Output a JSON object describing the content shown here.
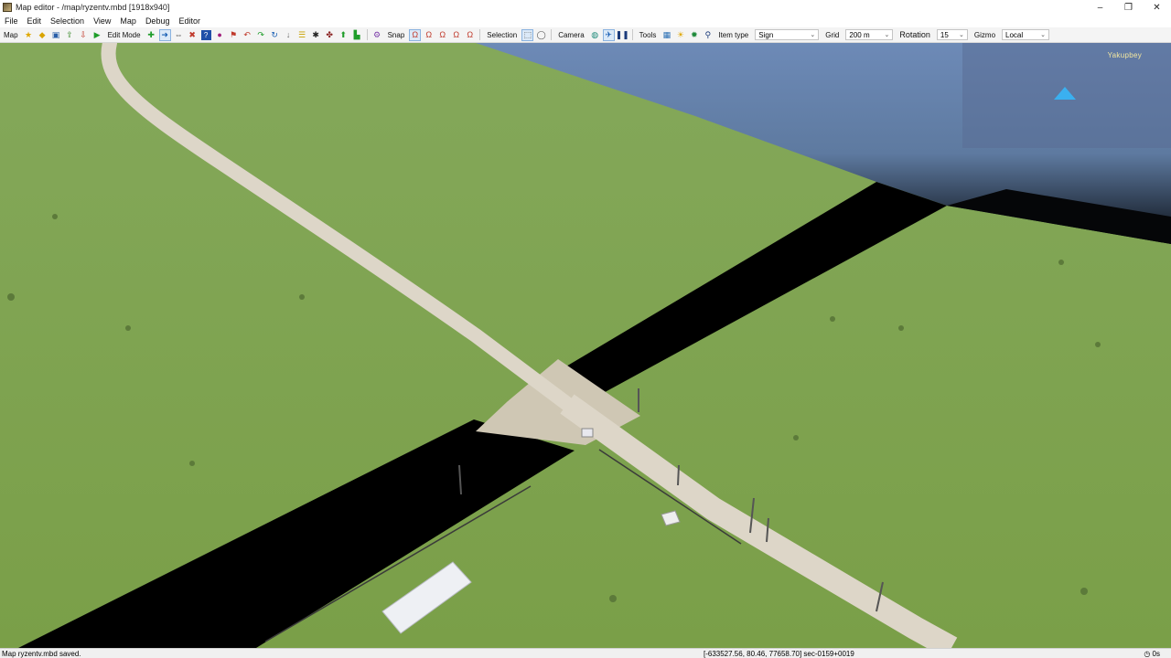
{
  "window": {
    "title": "Map editor - /map/ryzentv.mbd [1918x940]",
    "controls": {
      "minimize": "–",
      "maximize": "❐",
      "close": "✕"
    }
  },
  "menu": [
    "File",
    "Edit",
    "Selection",
    "View",
    "Map",
    "Debug",
    "Editor"
  ],
  "toolbar": {
    "map_label": "Map",
    "edit_mode_label": "Edit Mode",
    "snap_label": "Snap",
    "selection_label": "Selection",
    "camera_label": "Camera",
    "tools_label": "Tools",
    "item_type_label": "Item type",
    "item_type_value": "Sign",
    "grid_label": "Grid",
    "grid_value": "200 m",
    "rotation_label": "Rotation",
    "rotation_value": "15",
    "gizmo_label": "Gizmo",
    "gizmo_value": "Local"
  },
  "minimap": {
    "place_label": "Yakupbey"
  },
  "status": {
    "message": "Map ryzentv.mbd saved.",
    "coordinates": "[-633527.56, 80.46, 77658.70] sec-0159+0019",
    "timer": "0s"
  },
  "icons": {
    "map": [
      "star-icon",
      "new-map-icon",
      "save-icon",
      "export-icon",
      "import-icon",
      "play-icon"
    ],
    "edit": [
      "add-icon",
      "move-icon",
      "rotate-icon",
      "delete-icon",
      "help-icon",
      "record-icon",
      "flag-icon",
      "undo-icon",
      "redo-icon",
      "refresh-icon",
      "tool-a-icon",
      "tool-b-icon",
      "tool-c-icon",
      "tool-d-icon",
      "tool-e-icon",
      "tool-f-icon"
    ],
    "snap": [
      "snap-a-icon",
      "snap-b-icon",
      "snap-c-icon",
      "snap-d-icon",
      "snap-e-icon"
    ],
    "selection": [
      "select-rect-icon",
      "lasso-icon"
    ],
    "camera": [
      "orbit-icon",
      "fly-icon",
      "pause-icon"
    ],
    "tools": [
      "grid-tool-icon",
      "sun-icon",
      "gear-icon",
      "search-icon"
    ]
  },
  "colors": {
    "grass": "#7ea24c",
    "sky": "#6b86b2",
    "road": "#d9d3c5",
    "void": "#000000",
    "minimap_arrow": "#3ab0f0"
  }
}
